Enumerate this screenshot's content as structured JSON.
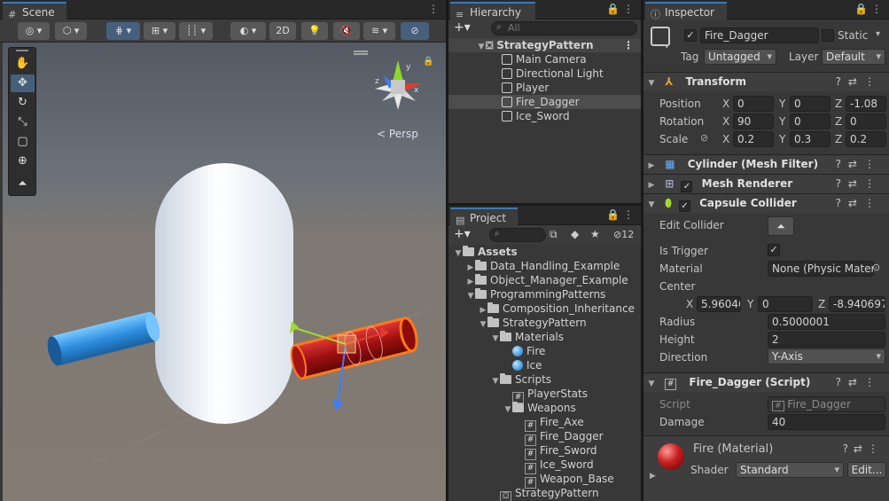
{
  "scene": {
    "tab_label": "Scene",
    "toolbar_2d": "2D",
    "persp_label": "Persp"
  },
  "hierarchy": {
    "tab_label": "Hierarchy",
    "search_placeholder": "All",
    "root": "StrategyPattern",
    "items": [
      "Main Camera",
      "Directional Light",
      "Player",
      "Fire_Dagger",
      "Ice_Sword"
    ],
    "selected_index": 3
  },
  "project": {
    "tab_label": "Project",
    "hidden_count": "12",
    "tree": [
      {
        "label": "Assets",
        "depth": 0,
        "kind": "folder",
        "expanded": true,
        "bold": true
      },
      {
        "label": "Data_Handling_Example",
        "depth": 1,
        "kind": "folder",
        "expanded": false
      },
      {
        "label": "Object_Manager_Example",
        "depth": 1,
        "kind": "folder",
        "expanded": false
      },
      {
        "label": "ProgrammingPatterns",
        "depth": 1,
        "kind": "folder",
        "expanded": true
      },
      {
        "label": "Composition_Inheritance",
        "depth": 2,
        "kind": "folder",
        "expanded": false
      },
      {
        "label": "StrategyPattern",
        "depth": 2,
        "kind": "folder",
        "expanded": true
      },
      {
        "label": "Materials",
        "depth": 3,
        "kind": "folder",
        "expanded": true
      },
      {
        "label": "Fire",
        "depth": 4,
        "kind": "material"
      },
      {
        "label": "Ice",
        "depth": 4,
        "kind": "material"
      },
      {
        "label": "Scripts",
        "depth": 3,
        "kind": "folder",
        "expanded": true
      },
      {
        "label": "PlayerStats",
        "depth": 4,
        "kind": "script"
      },
      {
        "label": "Weapons",
        "depth": 4,
        "kind": "folder",
        "expanded": true
      },
      {
        "label": "Fire_Axe",
        "depth": 5,
        "kind": "script"
      },
      {
        "label": "Fire_Dagger",
        "depth": 5,
        "kind": "script"
      },
      {
        "label": "Fire_Sword",
        "depth": 5,
        "kind": "script"
      },
      {
        "label": "Ice_Sword",
        "depth": 5,
        "kind": "script"
      },
      {
        "label": "Weapon_Base",
        "depth": 5,
        "kind": "script"
      },
      {
        "label": "StrategyPattern",
        "depth": 3,
        "kind": "scene"
      }
    ]
  },
  "inspector": {
    "tab_label": "Inspector",
    "object_name": "Fire_Dagger",
    "static_label": "Static",
    "tag_label": "Tag",
    "tag_value": "Untagged",
    "layer_label": "Layer",
    "layer_value": "Default",
    "transform": {
      "title": "Transform",
      "position_label": "Position",
      "rotation_label": "Rotation",
      "scale_label": "Scale",
      "position": {
        "x": "0",
        "y": "0",
        "z": "-1.08"
      },
      "rotation": {
        "x": "90",
        "y": "0",
        "z": "0"
      },
      "scale": {
        "x": "0.2",
        "y": "0.3",
        "z": "0.2"
      }
    },
    "mesh_filter_title": "Cylinder (Mesh Filter)",
    "mesh_renderer_title": "Mesh Renderer",
    "capsule": {
      "title": "Capsule Collider",
      "edit_collider_label": "Edit Collider",
      "is_trigger_label": "Is Trigger",
      "material_label": "Material",
      "material_value": "None (Physic Mater",
      "center_label": "Center",
      "center": {
        "x": "5.960464",
        "y": "0",
        "z": "-8.940697"
      },
      "radius_label": "Radius",
      "radius_value": "0.5000001",
      "height_label": "Height",
      "height_value": "2",
      "direction_label": "Direction",
      "direction_value": "Y-Axis"
    },
    "script_comp": {
      "title": "Fire_Dagger (Script)",
      "script_label": "Script",
      "script_value": "Fire_Dagger",
      "damage_label": "Damage",
      "damage_value": "40"
    },
    "material": {
      "title": "Fire (Material)",
      "shader_label": "Shader",
      "shader_value": "Standard",
      "edit_label": "Edit..."
    }
  },
  "axis_letters": {
    "x": "X",
    "y": "Y",
    "z": "Z"
  },
  "colors": {
    "accent": "#3a79bb",
    "fire": "#c81e1e",
    "ice": "#3aa0e8",
    "selection_outline": "#ff7a18"
  }
}
